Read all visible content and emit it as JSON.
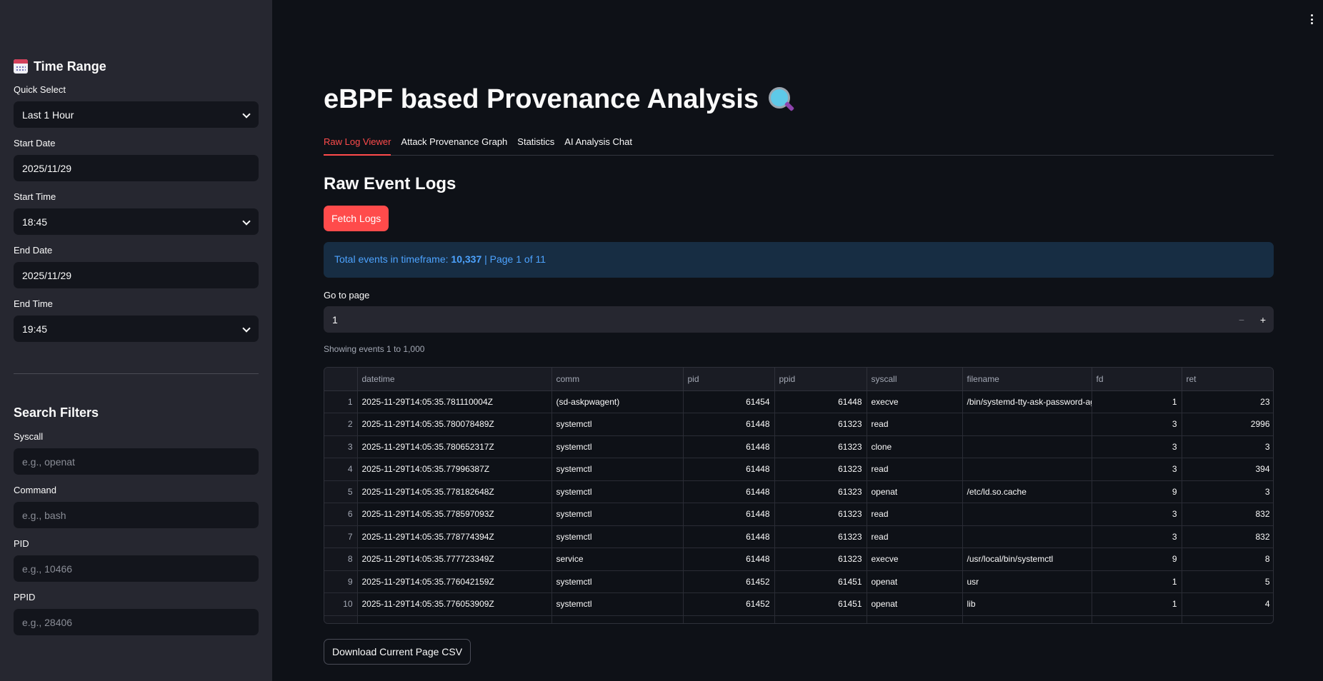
{
  "sidebar": {
    "time_range_title": "Time Range",
    "quick_select_label": "Quick Select",
    "quick_select_value": "Last 1 Hour",
    "start_date_label": "Start Date",
    "start_date_value": "2025/11/29",
    "start_time_label": "Start Time",
    "start_time_value": "18:45",
    "end_date_label": "End Date",
    "end_date_value": "2025/11/29",
    "end_time_label": "End Time",
    "end_time_value": "19:45",
    "search_filters_title": "Search Filters",
    "syscall_label": "Syscall",
    "syscall_placeholder": "e.g., openat",
    "command_label": "Command",
    "command_placeholder": "e.g., bash",
    "pid_label": "PID",
    "pid_placeholder": "e.g., 10466",
    "ppid_label": "PPID",
    "ppid_placeholder": "e.g., 28406"
  },
  "main": {
    "title": "eBPF based Provenance Analysis",
    "tabs": [
      {
        "label": "Raw Log Viewer"
      },
      {
        "label": "Attack Provenance Graph"
      },
      {
        "label": "Statistics"
      },
      {
        "label": "AI Analysis Chat"
      }
    ],
    "section_title": "Raw Event Logs",
    "fetch_button": "Fetch Logs",
    "info_prefix": "Total events in timeframe: ",
    "info_total": "10,337",
    "info_suffix": " | Page 1 of 11",
    "goto_label": "Go to page",
    "goto_value": "1",
    "showing_text": "Showing events 1 to 1,000",
    "download_button": "Download Current Page CSV"
  },
  "table": {
    "columns": [
      "",
      "datetime",
      "comm",
      "pid",
      "ppid",
      "syscall",
      "filename",
      "fd",
      "ret"
    ],
    "rows": [
      [
        "1",
        "2025-11-29T14:05:35.781110004Z",
        "(sd-askpwagent)",
        "61454",
        "61448",
        "execve",
        "/bin/systemd-tty-ask-password-agent",
        "1",
        "23"
      ],
      [
        "2",
        "2025-11-29T14:05:35.780078489Z",
        "systemctl",
        "61448",
        "61323",
        "read",
        "",
        "3",
        "2996"
      ],
      [
        "3",
        "2025-11-29T14:05:35.780652317Z",
        "systemctl",
        "61448",
        "61323",
        "clone",
        "",
        "3",
        "3"
      ],
      [
        "4",
        "2025-11-29T14:05:35.77996387Z",
        "systemctl",
        "61448",
        "61323",
        "read",
        "",
        "3",
        "394"
      ],
      [
        "5",
        "2025-11-29T14:05:35.778182648Z",
        "systemctl",
        "61448",
        "61323",
        "openat",
        "/etc/ld.so.cache",
        "9",
        "3"
      ],
      [
        "6",
        "2025-11-29T14:05:35.778597093Z",
        "systemctl",
        "61448",
        "61323",
        "read",
        "",
        "3",
        "832"
      ],
      [
        "7",
        "2025-11-29T14:05:35.778774394Z",
        "systemctl",
        "61448",
        "61323",
        "read",
        "",
        "3",
        "832"
      ],
      [
        "8",
        "2025-11-29T14:05:35.777723349Z",
        "service",
        "61448",
        "61323",
        "execve",
        "/usr/local/bin/systemctl",
        "9",
        "8"
      ],
      [
        "9",
        "2025-11-29T14:05:35.776042159Z",
        "systemctl",
        "61452",
        "61451",
        "openat",
        "usr",
        "1",
        "5"
      ],
      [
        "10",
        "2025-11-29T14:05:35.776053909Z",
        "systemctl",
        "61452",
        "61451",
        "openat",
        "lib",
        "1",
        "4"
      ]
    ]
  },
  "icons": {
    "calendar": "calendar-icon",
    "magnifier": "magnifying-glass-icon",
    "menu": "kebab-menu-icon"
  },
  "colors": {
    "accent": "#ff4b4b",
    "info_text": "#4da3ff",
    "info_bg": "#172d43",
    "sidebar_bg": "#262730",
    "main_bg": "#0e1117"
  }
}
